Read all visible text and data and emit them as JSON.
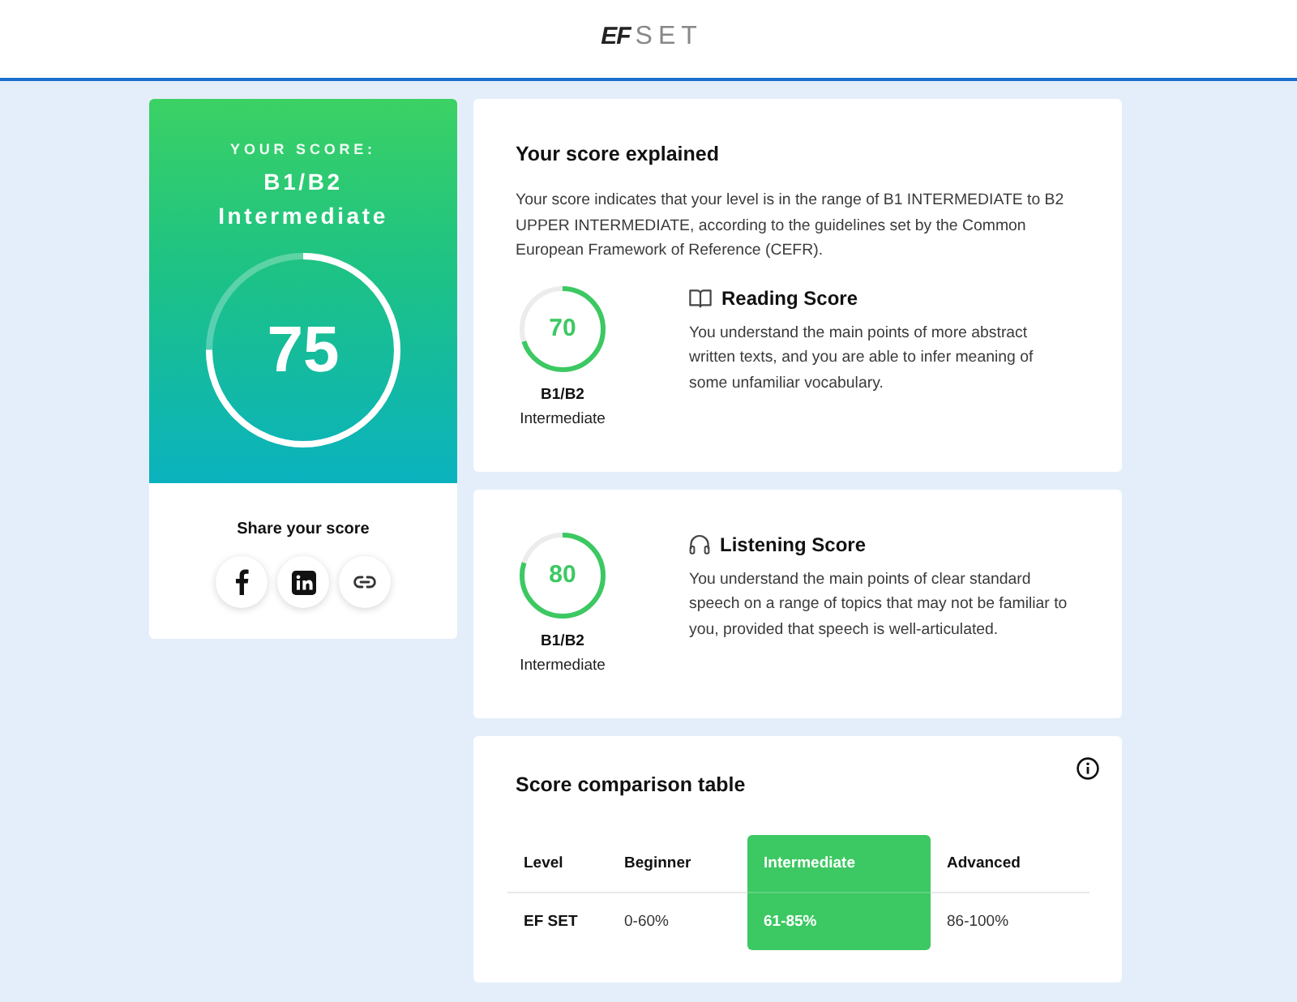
{
  "header": {
    "logo": {
      "mark": "EF",
      "name": "SET"
    }
  },
  "score_card": {
    "label": "YOUR SCORE:",
    "level_code": "B1/B2",
    "level_name": "Intermediate",
    "score": "75",
    "level": 0.75,
    "share_title": "Share your score"
  },
  "explanation": {
    "title": "Your score explained",
    "text": "Your score indicates that your level is in the range of B1 INTERMEDIATE to B2 UPPER INTERMEDIATE, according to the guidelines set by the Common European Framework of Reference (CEFR)."
  },
  "skills": [
    {
      "kind": "reading",
      "score": "70",
      "level": 0.7,
      "level_code": "B1/B2",
      "level_name": "Intermediate",
      "title": "Reading Score",
      "description": "You understand the main points of more abstract written texts, and you are able to infer meaning of some unfamiliar vocabulary."
    },
    {
      "kind": "listening",
      "score": "80",
      "level": 0.8,
      "level_code": "B1/B2",
      "level_name": "Intermediate",
      "title": "Listening Score",
      "description": "You understand the main points of clear standard speech on a range of topics that may not be familiar to you, provided that speech is well-articulated."
    }
  ],
  "comparison": {
    "title": "Score comparison table",
    "columns": [
      {
        "label": "Level",
        "selected": false
      },
      {
        "label": "Beginner",
        "selected": false
      },
      {
        "label": "Intermediate",
        "selected": true
      },
      {
        "label": "Advanced",
        "selected": false
      }
    ],
    "rows": [
      {
        "cells": [
          "EF SET",
          "0-60%",
          "61-85%",
          "86-100%"
        ]
      }
    ]
  }
}
